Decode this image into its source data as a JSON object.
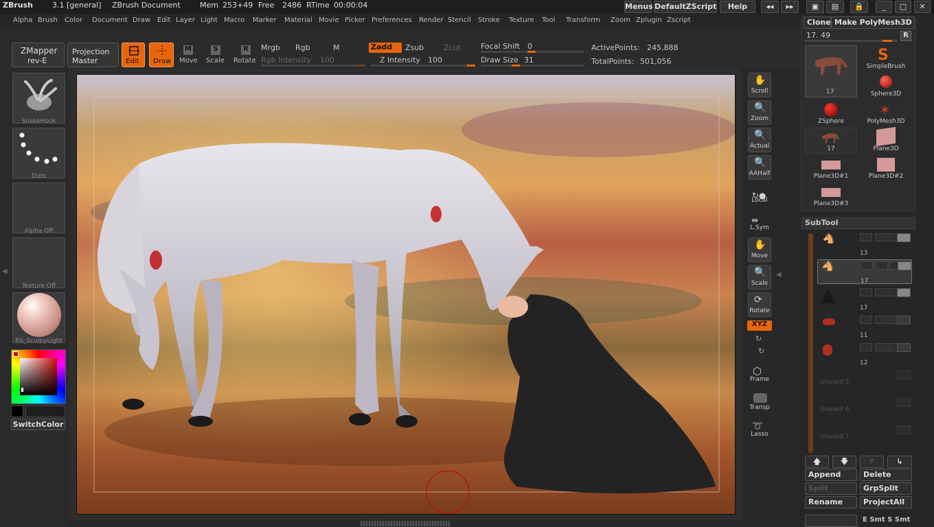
{
  "title_bar": {
    "app": "ZBrush",
    "version": "3.1 [general]",
    "document": "ZBrush Document",
    "mem_label": "Mem",
    "mem_value": "253+49",
    "free_label": "Free",
    "free_value": "2486",
    "rtime_label": "RTime",
    "rtime_value": "00:00:04",
    "menus_button": "Menus",
    "script_button": "DefaultZScript",
    "help_button": "Help"
  },
  "menu_bar": [
    "Alpha",
    "Brush",
    "Color",
    "Document",
    "Draw",
    "Edit",
    "Layer",
    "Light",
    "Macro",
    "Marker",
    "Material",
    "Movie",
    "Picker",
    "Preferences",
    "Render",
    "Stencil",
    "Stroke",
    "Texture",
    "Tool",
    "Transform",
    "Zoom",
    "Zplugin",
    "Zscript"
  ],
  "shelf": {
    "zmapper_line1": "ZMapper",
    "zmapper_line2": "rev-E",
    "projection_line1": "Projection",
    "projection_line2": "Master",
    "edit": "Edit",
    "draw": "Draw",
    "move": "Move",
    "scale": "Scale",
    "rotate": "Rotate",
    "mrgb": "Mrgb",
    "rgb": "Rgb",
    "m": "M",
    "rgb_intensity_label": "Rgb Intensity",
    "rgb_intensity_value": "100",
    "zadd": "Zadd",
    "zsub": "Zsub",
    "zcut": "Zcut",
    "z_intensity_label": "Z Intensity",
    "z_intensity_value": "100",
    "focal_shift_label": "Focal Shift",
    "focal_shift_value": "0",
    "draw_size_label": "Draw Size",
    "draw_size_value": "31",
    "active_points_label": "ActivePoints:",
    "active_points_value": "245,888",
    "total_points_label": "TotalPoints:",
    "total_points_value": "501,056"
  },
  "left_tray": {
    "brush": "SnakeHook",
    "stroke": "Dots",
    "alpha": "Alpha Off",
    "texture": "Texture Off",
    "material": "RS_SculpyLight",
    "switch_color": "SwitchColor"
  },
  "right_tools": [
    "Scroll",
    "Zoom",
    "Actual",
    "AAHalf",
    "Local",
    "L.Sym",
    "Move",
    "Scale",
    "Rotate",
    "XYZ",
    "Frame",
    "Transp",
    "Lasso"
  ],
  "tool_panel": {
    "clone": "Clone",
    "make_polymesh": "Make PolyMesh3D",
    "slider_value": "17. 49",
    "r_button": "R",
    "main_tool_count": "17",
    "tools": [
      {
        "label": "SimpleBrush"
      },
      {
        "label": "Sphere3D"
      },
      {
        "label": "ZSphere"
      },
      {
        "label": "PolyMesh3D"
      },
      {
        "label": "17"
      },
      {
        "label": "Plane3D"
      },
      {
        "label": "Plane3D#1"
      },
      {
        "label": "Plane3D#2"
      },
      {
        "label": "Plane3D#3"
      }
    ]
  },
  "subtool": {
    "header": "SubTool",
    "rows": [
      {
        "label": "13"
      },
      {
        "label": "17"
      },
      {
        "label": "17"
      },
      {
        "label": "11"
      },
      {
        "label": "12"
      },
      {
        "label": "Unused 5"
      },
      {
        "label": "Unused 6"
      },
      {
        "label": "Unused 7"
      }
    ],
    "append": "Append",
    "delete": "Delete",
    "split": "Split",
    "grpsplit": "GrpSplit",
    "rename": "Rename",
    "projectall": "ProjectAll",
    "bottom_labels": "E Smt S Smt"
  },
  "colors": {
    "accent": "#e8650b",
    "background": "#282828"
  }
}
